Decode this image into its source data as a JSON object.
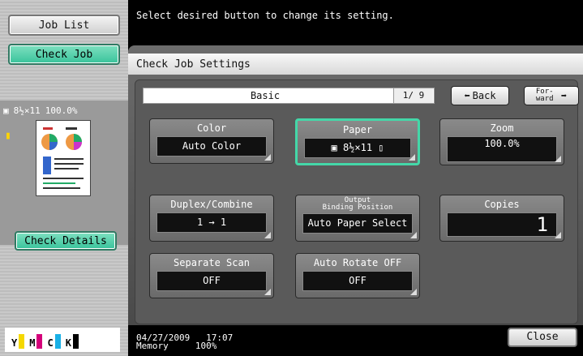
{
  "sidebar": {
    "job_list_label": "Job List",
    "check_job_label": "Check Job",
    "thumb_paper_icon": "paper-icon",
    "thumb_paper_size": "8½×11",
    "thumb_zoom": "100.0%",
    "check_details_label": "Check Details",
    "toner": [
      "Y",
      "M",
      "C",
      "K"
    ]
  },
  "message": "Select desired button to change its setting.",
  "panel": {
    "title": "Check Job Settings",
    "tab_label": "Basic",
    "page_indicator": "1/ 9",
    "back_label": "Back",
    "forward_label": "For- ward"
  },
  "settings": [
    {
      "label": "Color",
      "value": "Auto Color",
      "selected": false
    },
    {
      "label": "Paper",
      "value": "8½×11",
      "selected": true
    },
    {
      "label": "Zoom",
      "value": "100.0%",
      "selected": false
    },
    {
      "label": "Duplex/Combine",
      "value": "1 → 1",
      "selected": false
    },
    {
      "label_top": "Output",
      "label_bottom": "Binding Position",
      "value": "Auto Paper Select",
      "selected": false
    },
    {
      "label": "Copies",
      "value": "1",
      "selected": false
    },
    {
      "label": "Separate Scan",
      "value": "OFF",
      "selected": false
    },
    {
      "label": "Auto Rotate OFF",
      "value": "OFF",
      "selected": false
    }
  ],
  "status": {
    "date": "04/27/2009",
    "time": "17:07",
    "memory_label": "Memory",
    "memory_value": "100%"
  },
  "close_label": "Close",
  "colors": {
    "accent": "#44d7a8",
    "green_button": "#39c39b"
  }
}
